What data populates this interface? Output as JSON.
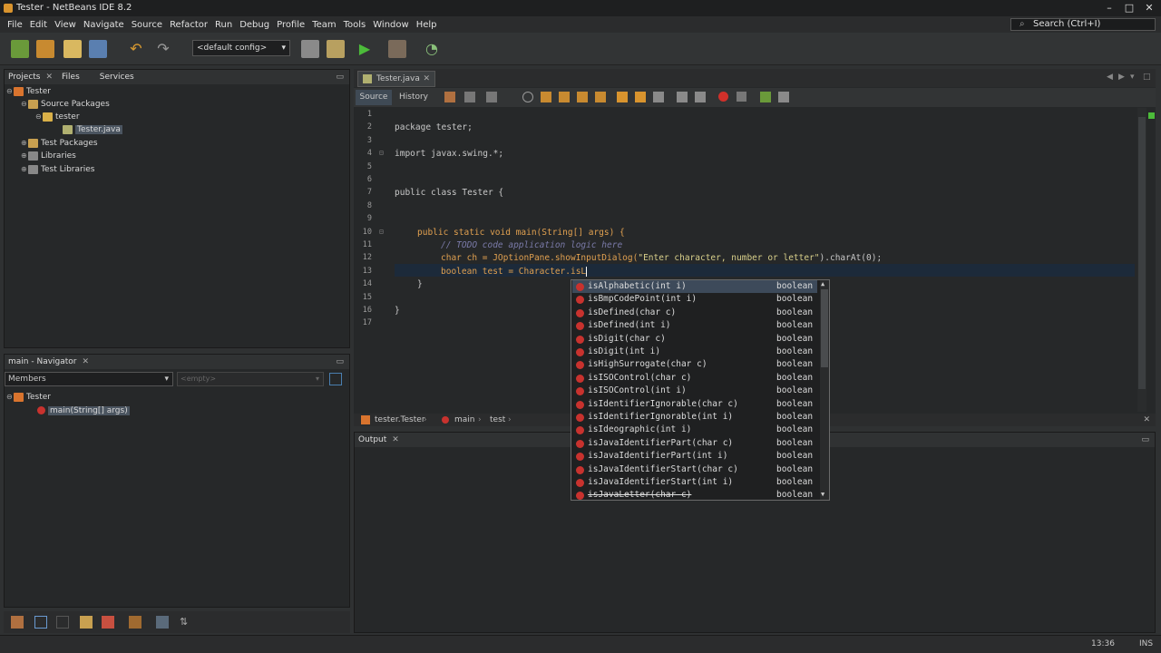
{
  "window": {
    "title": "Tester - NetBeans IDE 8.2"
  },
  "menu": [
    "File",
    "Edit",
    "View",
    "Navigate",
    "Source",
    "Refactor",
    "Run",
    "Debug",
    "Profile",
    "Team",
    "Tools",
    "Window",
    "Help"
  ],
  "search": {
    "placeholder": "Search (Ctrl+I)"
  },
  "toolbar": {
    "config": "<default config>"
  },
  "projects_panel": {
    "tabs": [
      "Projects",
      "Files",
      "Services"
    ],
    "tree": [
      {
        "label": "Tester",
        "level": 0
      },
      {
        "label": "Source Packages",
        "level": 1
      },
      {
        "label": "tester",
        "level": 2
      },
      {
        "label": "Tester.java",
        "level": 3
      },
      {
        "label": "Test Packages",
        "level": 1
      },
      {
        "label": "Libraries",
        "level": 1
      },
      {
        "label": "Test Libraries",
        "level": 1
      }
    ]
  },
  "navigator": {
    "title": "main - Navigator",
    "filter": "Members",
    "empty": "<empty>",
    "root": "Tester",
    "member": "main(String[] args)"
  },
  "editor": {
    "tab": "Tester.java",
    "source_tab": "Source",
    "history_tab": "History",
    "lines": [
      "1",
      "2",
      "3",
      "4",
      "5",
      "6",
      "7",
      "8",
      "9",
      "10",
      "11",
      "12",
      "13",
      "14",
      "15",
      "16",
      "17"
    ],
    "code": {
      "l2": "package tester;",
      "l4": "import javax.swing.*;",
      "l7": "public class Tester {",
      "l10": "public static void main(String[] args) {",
      "l11": "// TODO code application logic here",
      "l12a": "char ch = JOptionPane.showInputDialog(",
      "l12b": "\"Enter character, number or letter\"",
      "l12c": ").charAt(0);",
      "l13": "boolean test = Character.isL",
      "l14": "}",
      "l16": "}"
    },
    "breadcrumb": [
      "tester.Tester",
      "main",
      "test"
    ]
  },
  "autocomplete": {
    "items": [
      {
        "name": "isAlphabetic(int i)",
        "type": "boolean"
      },
      {
        "name": "isBmpCodePoint(int i)",
        "type": "boolean"
      },
      {
        "name": "isDefined(char c)",
        "type": "boolean"
      },
      {
        "name": "isDefined(int i)",
        "type": "boolean"
      },
      {
        "name": "isDigit(char c)",
        "type": "boolean"
      },
      {
        "name": "isDigit(int i)",
        "type": "boolean"
      },
      {
        "name": "isHighSurrogate(char c)",
        "type": "boolean"
      },
      {
        "name": "isISOControl(char c)",
        "type": "boolean"
      },
      {
        "name": "isISOControl(int i)",
        "type": "boolean"
      },
      {
        "name": "isIdentifierIgnorable(char c)",
        "type": "boolean"
      },
      {
        "name": "isIdentifierIgnorable(int i)",
        "type": "boolean"
      },
      {
        "name": "isIdeographic(int i)",
        "type": "boolean"
      },
      {
        "name": "isJavaIdentifierPart(char c)",
        "type": "boolean"
      },
      {
        "name": "isJavaIdentifierPart(int i)",
        "type": "boolean"
      },
      {
        "name": "isJavaIdentifierStart(char c)",
        "type": "boolean"
      },
      {
        "name": "isJavaIdentifierStart(int i)",
        "type": "boolean"
      },
      {
        "name": "isJavaLetter(char c)",
        "type": "boolean"
      }
    ]
  },
  "output": {
    "title": "Output"
  },
  "status": {
    "position": "13:36",
    "mode": "INS"
  }
}
